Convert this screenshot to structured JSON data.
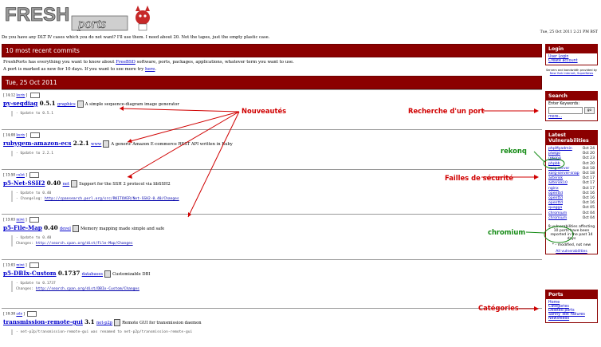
{
  "logo": {
    "text_a": "FRESH",
    "text_b": "ports"
  },
  "tagline": "Do you have any DLT IV cases which you do not want? I'll use them. I need about 20. Not the tapes, just the empty plastic case.",
  "server_date": "Tue, 25 Oct 2011 2:21 PM BST",
  "commits_header": "10 most recent commits",
  "intro": {
    "line1_pre": "FreshPorts has everything you want to know about ",
    "line1_link": "FreeBSD",
    "line1_post": " software, ports, packages, applications, whatever term you want to use.",
    "line2_pre": "A port is marked as new for 10 days. If you want to see more try ",
    "line2_link": "here",
    "line2_post": "."
  },
  "date_header": "Tue, 25 Oct 2011",
  "entries": [
    {
      "time": "14:12",
      "user": "kuriy",
      "name": "py-seqdiag",
      "version": "0.5.1",
      "category": "graphics",
      "description": "A simple sequence-diagram image generator",
      "commit": [
        "- Update to 0.5.1"
      ]
    },
    {
      "time": "14:08",
      "user": "kuriy",
      "name": "rubygem-amazon-ecs",
      "version": "2.2.1",
      "category": "www",
      "description": "A generic Amazon E-commerce REST API written in Ruby",
      "commit": [
        "- Update to 2.2.1"
      ]
    },
    {
      "time": "13:50",
      "user": "culot",
      "name": "p5-Net-SSH2",
      "version": "0.40",
      "category": "net",
      "description": "Support for the SSH 2 protocol via libSSH2",
      "commit": [
        "- Update to 0.40",
        "- Changelog: "
      ],
      "commit_url": "http://cpansearch.perl.org/src/RKITOVER/Net-SSH2-0.40/Changes"
    },
    {
      "time": "13:03",
      "user": "miwi",
      "name": "p5-File-Map",
      "version": "0.40",
      "category": "devel",
      "description": "Memory mapping made simple and safe",
      "commit": [
        "- Update to 0.40",
        "Changes:"
      ],
      "commit_url": "http://search.cpan.org/dist/File-Map/Changes"
    },
    {
      "time": "13:03",
      "user": "miwi",
      "name": "p5-DBIx-Custom",
      "version": "0.1737",
      "category": "databases",
      "description": "Customizable DBI",
      "commit": [
        "- Update to 0.1737",
        "Changes:"
      ],
      "commit_url": "http://search.cpan.org/dist/DBIx-Custom/Changes"
    },
    {
      "time": "10:38",
      "user": "ade",
      "name": "transmission-remote-gui",
      "version": "3.1",
      "category": "net-p2p",
      "description": "Remote GUI for transmission daemon",
      "commit": [
        "- net-p2p/transmission-remote-gui was renamed to net-p2p/transmission-remote-gui"
      ]
    }
  ],
  "login": {
    "title": "Login",
    "links": [
      "User Login",
      "Create account"
    ],
    "note": "Servers and bandwidth provided by",
    "sponsor": "New York Internet, SuperNews"
  },
  "search": {
    "title": "Search",
    "label": "Enter Keywords:",
    "button": "go",
    "more": "more..."
  },
  "vulns": {
    "title": "Latest Vulnerabilities",
    "items": [
      {
        "name": "phpMyadmin",
        "date": "Oct 24"
      },
      {
        "name": "piwigo",
        "date": "Oct 20"
      },
      {
        "name": "rekonq",
        "date": "Oct 23"
      },
      {
        "name": "phpbb",
        "date": "Oct 20"
      },
      {
        "name": "xorg-server",
        "date": "Oct 18"
      },
      {
        "name": "xorg-server-snap",
        "date": "Oct 18"
      },
      {
        "name": "asterisk",
        "date": "Oct 17"
      },
      {
        "name": "asterisk10",
        "date": "Oct 17"
      },
      {
        "name": "nginx",
        "date": "Oct 17"
      },
      {
        "name": "openttd",
        "date": "Oct 16"
      },
      {
        "name": "openttd",
        "date": "Oct 16"
      },
      {
        "name": "openttd",
        "date": "Oct 16"
      },
      {
        "name": "quagga",
        "date": "Oct 05"
      },
      {
        "name": "chromium",
        "date": "Oct 04"
      },
      {
        "name": "chromium",
        "date": "Oct 04"
      }
    ],
    "summary": "9 vulnerabilities affecting 10 ports have been reported in the past 14 days",
    "legend": "* - modified, not new",
    "all_link": "All vulnerabilities"
  },
  "ports": {
    "title": "Ports",
    "items": [
      "Home",
      "Categories",
      "Deleted ports",
      "Sanity Test Failures",
      "Newsfeeds"
    ]
  },
  "annotations": {
    "nouveautes": "Nouveautés",
    "recherche": "Recherche d'un port",
    "rekonq": "rekonq",
    "failles": "Failles de sécurité",
    "chromium": "chromium",
    "categories": "Catégories"
  }
}
